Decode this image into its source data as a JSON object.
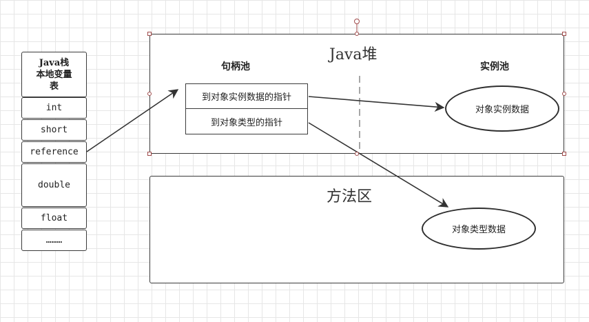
{
  "stack": {
    "header": "Java栈\n本地变量\n表",
    "cells": [
      "int",
      "short",
      "reference",
      "double",
      "float",
      "………"
    ]
  },
  "heap": {
    "title": "Java堆",
    "handle_pool_label": "句柄池",
    "instance_pool_label": "实例池",
    "pointer_instance": "到对象实例数据的指针",
    "pointer_type": "到对象类型的指针",
    "instance_data": "对象实例数据"
  },
  "method_area": {
    "title": "方法区",
    "type_data": "对象类型数据"
  }
}
